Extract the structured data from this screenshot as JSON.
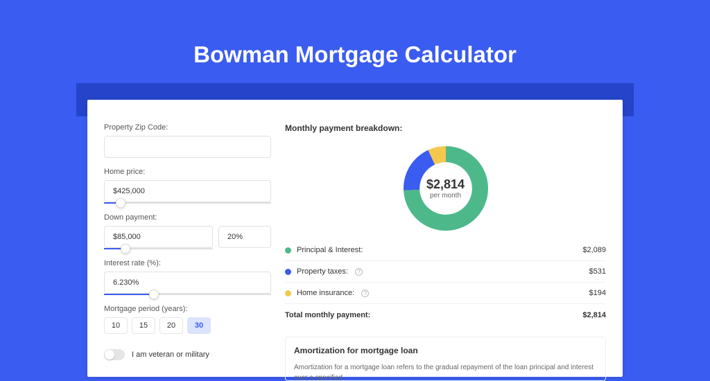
{
  "page_title": "Bowman Mortgage Calculator",
  "form": {
    "zip_label": "Property Zip Code:",
    "zip_value": "",
    "home_price_label": "Home price:",
    "home_price_value": "$425,000",
    "home_price_slider_pct": 10,
    "down_payment_label": "Down payment:",
    "down_payment_amount": "$85,000",
    "down_payment_pct": "20%",
    "down_payment_slider_pct": 20,
    "interest_label": "Interest rate (%):",
    "interest_value": "6.230%",
    "interest_slider_pct": 30,
    "period_label": "Mortgage period (years):",
    "periods": [
      {
        "label": "10",
        "active": false
      },
      {
        "label": "15",
        "active": false
      },
      {
        "label": "20",
        "active": false
      },
      {
        "label": "30",
        "active": true
      }
    ],
    "veteran_label": "I am veteran or military",
    "veteran_on": false
  },
  "breakdown": {
    "title": "Monthly payment breakdown:",
    "total_amount": "$2,814",
    "total_sub": "per month",
    "items": [
      {
        "label": "Principal & Interest:",
        "value": "$2,089",
        "color": "#4DB98A",
        "info": false
      },
      {
        "label": "Property taxes:",
        "value": "$531",
        "color": "#3A5CF0",
        "info": true
      },
      {
        "label": "Home insurance:",
        "value": "$194",
        "color": "#F4C84E",
        "info": true
      }
    ],
    "total_row": {
      "label": "Total monthly payment:",
      "value": "$2,814"
    }
  },
  "amortization": {
    "title": "Amortization for mortgage loan",
    "body": "Amortization for a mortgage loan refers to the gradual repayment of the loan principal and interest over a specified"
  },
  "chart_data": {
    "type": "pie",
    "title": "Monthly payment breakdown",
    "series": [
      {
        "name": "Principal & Interest",
        "value": 2089,
        "color": "#4DB98A"
      },
      {
        "name": "Property taxes",
        "value": 531,
        "color": "#3A5CF0"
      },
      {
        "name": "Home insurance",
        "value": 194,
        "color": "#F4C84E"
      }
    ],
    "total": 2814,
    "inner_radius_ratio": 0.62
  }
}
